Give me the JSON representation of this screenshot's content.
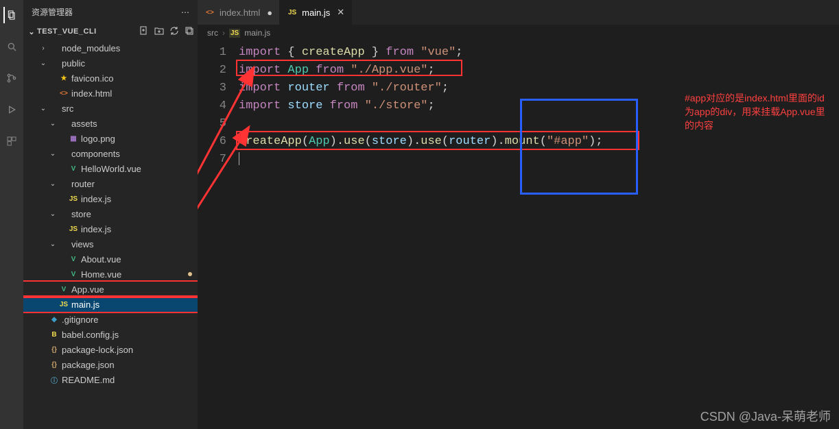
{
  "activityBar": {
    "items": [
      {
        "name": "explorer",
        "active": true
      },
      {
        "name": "search",
        "active": false
      },
      {
        "name": "source-control",
        "active": false
      },
      {
        "name": "run-debug",
        "active": false
      },
      {
        "name": "extensions",
        "active": false
      }
    ]
  },
  "sidebar": {
    "title": "资源管理器",
    "projectName": "TEST_VUE_CLI",
    "tree": [
      {
        "label": "node_modules",
        "depth": 1,
        "folder": true,
        "open": false,
        "iconColor": "#c09553"
      },
      {
        "label": "public",
        "depth": 1,
        "folder": true,
        "open": true,
        "iconColor": "#c09553"
      },
      {
        "label": "favicon.ico",
        "depth": 2,
        "folder": false,
        "iconColor": "#f5c518",
        "icon": "star"
      },
      {
        "label": "index.html",
        "depth": 2,
        "folder": false,
        "iconColor": "#e37933",
        "icon": "html"
      },
      {
        "label": "src",
        "depth": 1,
        "folder": true,
        "open": true,
        "iconColor": "#c09553"
      },
      {
        "label": "assets",
        "depth": 2,
        "folder": true,
        "open": true,
        "iconColor": "#c09553"
      },
      {
        "label": "logo.png",
        "depth": 3,
        "folder": false,
        "iconColor": "#a074c4",
        "icon": "image"
      },
      {
        "label": "components",
        "depth": 2,
        "folder": true,
        "open": true,
        "iconColor": "#c09553"
      },
      {
        "label": "HelloWorld.vue",
        "depth": 3,
        "folder": false,
        "iconColor": "#41b883",
        "icon": "vue"
      },
      {
        "label": "router",
        "depth": 2,
        "folder": true,
        "open": true,
        "iconColor": "#c09553"
      },
      {
        "label": "index.js",
        "depth": 3,
        "folder": false,
        "iconColor": "#f0db4f",
        "icon": "js"
      },
      {
        "label": "store",
        "depth": 2,
        "folder": true,
        "open": true,
        "iconColor": "#c09553"
      },
      {
        "label": "index.js",
        "depth": 3,
        "folder": false,
        "iconColor": "#f0db4f",
        "icon": "js"
      },
      {
        "label": "views",
        "depth": 2,
        "folder": true,
        "open": true,
        "iconColor": "#c09553"
      },
      {
        "label": "About.vue",
        "depth": 3,
        "folder": false,
        "iconColor": "#41b883",
        "icon": "vue"
      },
      {
        "label": "Home.vue",
        "depth": 3,
        "folder": false,
        "iconColor": "#41b883",
        "icon": "vue",
        "modified": true
      },
      {
        "label": "App.vue",
        "depth": 2,
        "folder": false,
        "iconColor": "#41b883",
        "icon": "vue",
        "hl": true
      },
      {
        "label": "main.js",
        "depth": 2,
        "folder": false,
        "iconColor": "#f0db4f",
        "icon": "js",
        "selected": true,
        "hl": true
      },
      {
        "label": ".gitignore",
        "depth": 1,
        "folder": false,
        "iconColor": "#3c9ec6",
        "icon": "git"
      },
      {
        "label": "babel.config.js",
        "depth": 1,
        "folder": false,
        "iconColor": "#f0db4f",
        "icon": "babel"
      },
      {
        "label": "package-lock.json",
        "depth": 1,
        "folder": false,
        "iconColor": "#c9a26b",
        "icon": "json"
      },
      {
        "label": "package.json",
        "depth": 1,
        "folder": false,
        "iconColor": "#c9a26b",
        "icon": "json"
      },
      {
        "label": "README.md",
        "depth": 1,
        "folder": false,
        "iconColor": "#519aba",
        "icon": "info"
      }
    ]
  },
  "tabs": [
    {
      "label": "index.html",
      "icon": "html",
      "active": false,
      "dirty": true
    },
    {
      "label": "main.js",
      "icon": "js",
      "active": true,
      "dirty": false
    }
  ],
  "breadcrumb": {
    "seg1": "src",
    "seg2": "main.js",
    "seg2icon": "js"
  },
  "code": {
    "lineNumbers": [
      "1",
      "2",
      "3",
      "4",
      "5",
      "6",
      "7"
    ],
    "lines": {
      "l1": {
        "kw": "import",
        "pn1": " { ",
        "fn": "createApp",
        "pn2": " } ",
        "from": "from",
        "sp": " ",
        "str": "\"vue\"",
        "sc": ";"
      },
      "l2": {
        "kw": "import",
        "sp1": " ",
        "cls": "App",
        "sp2": " ",
        "from": "from",
        "sp3": " ",
        "str": "\"./App.vue\"",
        "sc": ";"
      },
      "l3": {
        "kw": "import",
        "sp1": " ",
        "id": "router",
        "sp2": " ",
        "from": "from",
        "sp3": " ",
        "str": "\"./router\"",
        "sc": ";"
      },
      "l4": {
        "kw": "import",
        "sp1": " ",
        "id": "store",
        "sp2": " ",
        "from": "from",
        "sp3": " ",
        "str": "\"./store\"",
        "sc": ";"
      },
      "l6": {
        "fn1": "createApp",
        "p1": "(",
        "cls": "App",
        "p2": ").",
        "fn2": "use",
        "p3": "(",
        "id1": "store",
        "p4": ").",
        "fn3": "use",
        "p5": "(",
        "id2": "router",
        "p6": ").",
        "fn4": "mount",
        "p7": "(",
        "str": "\"#app\"",
        "p8": ");"
      }
    }
  },
  "annotation": "#app对应的是index.html里面的id为app的div，用来挂载App.vue里的内容",
  "watermark": "CSDN @Java-呆萌老师"
}
